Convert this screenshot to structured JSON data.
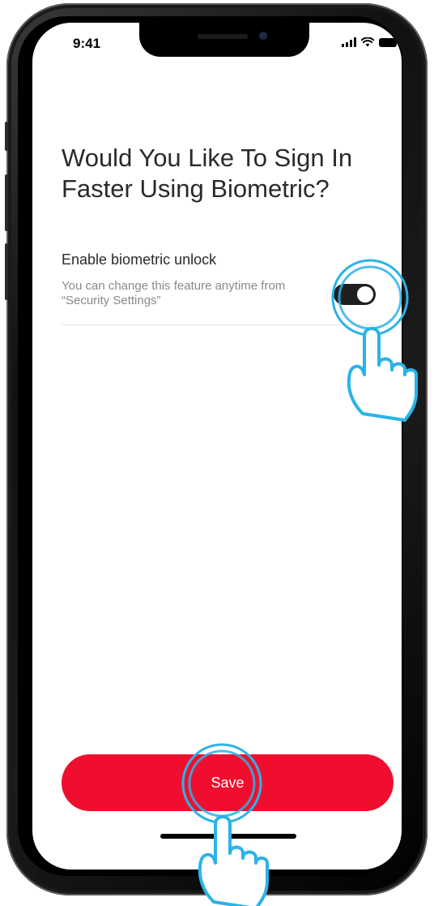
{
  "status_bar": {
    "time": "9:41"
  },
  "screen": {
    "title": "Would You Like To Sign In Faster Using Biometric?",
    "setting": {
      "label": "Enable biometric unlock",
      "description": "You can change this feature anytime from “Security Settings”",
      "toggle_state": "on"
    },
    "save_label": "Save"
  },
  "colors": {
    "accent": "#f00e2e",
    "toggle_on": "#1e1e1e",
    "hint": "#2bb3e8"
  },
  "icons": {
    "tap_hint": "hand-pointer-icon",
    "signal": "cellular-signal-icon",
    "wifi": "wifi-icon",
    "battery": "battery-icon"
  }
}
